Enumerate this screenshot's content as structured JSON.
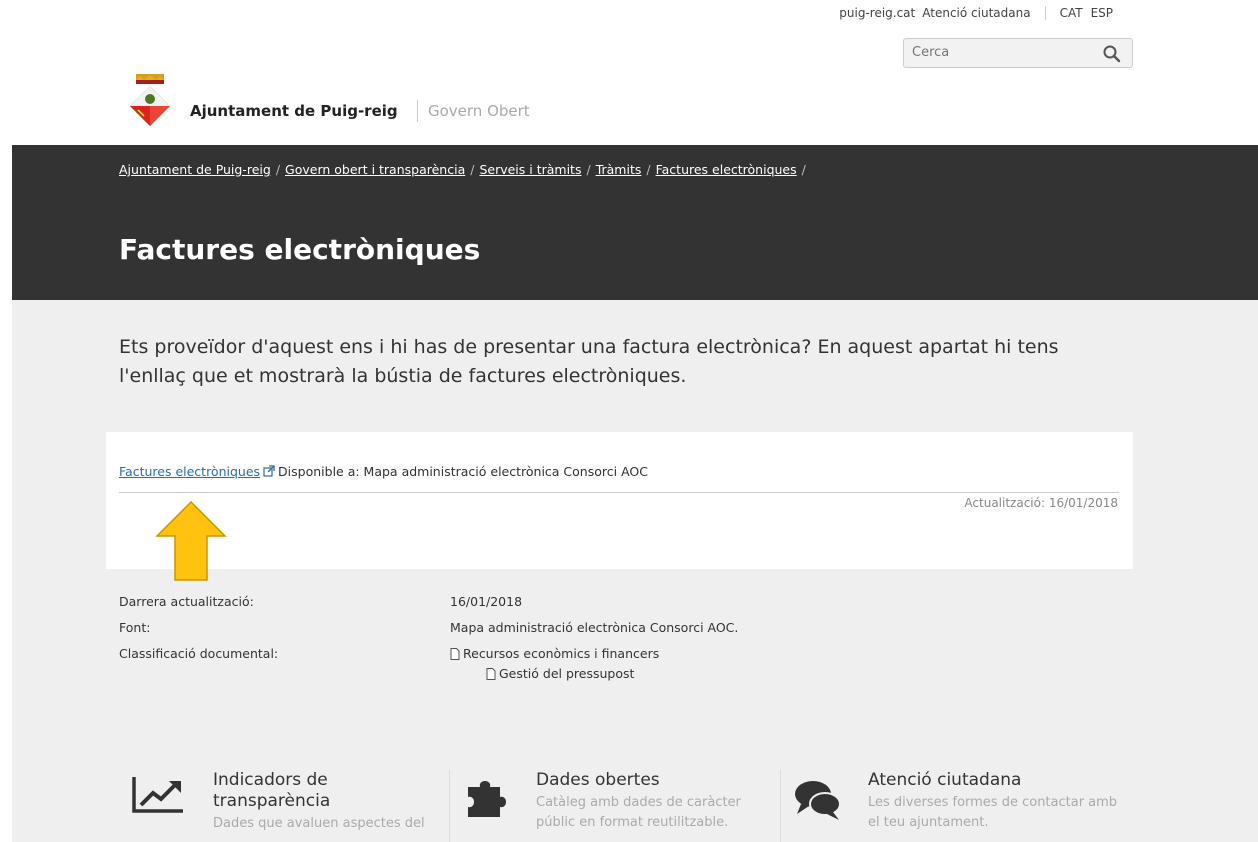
{
  "topbar": {
    "links": [
      "puig-reig.cat",
      "Atenció ciutadana"
    ],
    "lang": [
      "CAT",
      "ESP"
    ]
  },
  "search": {
    "placeholder": "Cerca"
  },
  "brand": {
    "name": "Ajuntament de Puig-reig",
    "section": "Govern Obert"
  },
  "breadcrumb": [
    "Ajuntament de Puig-reig",
    "Govern obert i transparència",
    "Serveis i tràmits",
    "Tràmits",
    "Factures electròniques"
  ],
  "page_title": "Factures electròniques",
  "intro": "Ets proveïdor d'aquest ens i hi has de presentar una factura electrònica? En aquest apartat hi tens l'enllaç que et mostrarà la bústia de factures electròniques.",
  "resource": {
    "link": "Factures electròniques",
    "available": "Disponible a: Mapa administració electrònica Consorci AOC",
    "updated": "Actualització: 16/01/2018"
  },
  "meta": {
    "last_update_label": "Darrera actualització:",
    "last_update": "16/01/2018",
    "source_label": "Font:",
    "source": "Mapa administració electrònica Consorci AOC.",
    "classification_label": "Classificació documental:",
    "classification": [
      "Recursos econòmics i financers",
      "Gestió del pressupost"
    ]
  },
  "features": [
    {
      "title": "Indicadors de transparència",
      "desc": "Dades que avaluen aspectes del",
      "icon": "chart-line-icon"
    },
    {
      "title": "Dades obertes",
      "desc": "Catàleg amb dades de caràcter públic en format reutilitzable.",
      "icon": "puzzle-icon"
    },
    {
      "title": "Atenció ciutadana",
      "desc": "Les diverses formes de contactar amb el teu ajuntament.",
      "icon": "chat-bubbles-icon"
    }
  ],
  "colors": {
    "hero": "#333333",
    "link": "#2a6fa8",
    "arrow": "#ffc20e",
    "bg": "#efefef"
  }
}
